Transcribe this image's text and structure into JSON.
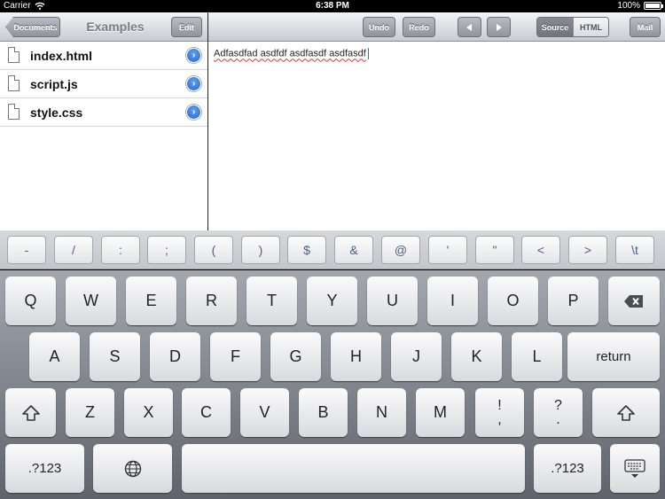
{
  "status_bar": {
    "carrier": "Carrier",
    "time": "6:38 PM",
    "battery": "100%",
    "battery_level": 1.0
  },
  "left_toolbar": {
    "back_label": "Documents",
    "title": "Examples",
    "edit_label": "Edit"
  },
  "right_toolbar": {
    "undo_label": "Undo",
    "redo_label": "Redo",
    "source_label": "Source",
    "html_label": "HTML",
    "mail_label": "Mail"
  },
  "files": [
    {
      "name": "index.html"
    },
    {
      "name": "script.js"
    },
    {
      "name": "style.css"
    }
  ],
  "editor": {
    "text": "Adfasdfad asdfdf asdfasdf asdfasdf"
  },
  "symbol_row": [
    "-",
    "/",
    ":",
    ";",
    "(",
    ")",
    "$",
    "&",
    "@",
    "'",
    "\"",
    "<",
    ">",
    "\\t"
  ],
  "keyboard": {
    "row1": [
      "Q",
      "W",
      "E",
      "R",
      "T",
      "Y",
      "U",
      "I",
      "O",
      "P"
    ],
    "row2": [
      "A",
      "S",
      "D",
      "F",
      "G",
      "H",
      "J",
      "K",
      "L"
    ],
    "return_label": "return",
    "row3": [
      "Z",
      "X",
      "C",
      "V",
      "B",
      "N",
      "M"
    ],
    "punct1": [
      "!",
      ","
    ],
    "punct2": [
      "?",
      "."
    ],
    "numbers_label": ".?123"
  },
  "icons": [
    "wifi-icon",
    "battery-icon",
    "document-icon",
    "disclosure-icon",
    "left-arrow-icon",
    "right-arrow-icon",
    "backspace-icon",
    "shift-icon",
    "globe-icon",
    "hide-keyboard-icon"
  ]
}
